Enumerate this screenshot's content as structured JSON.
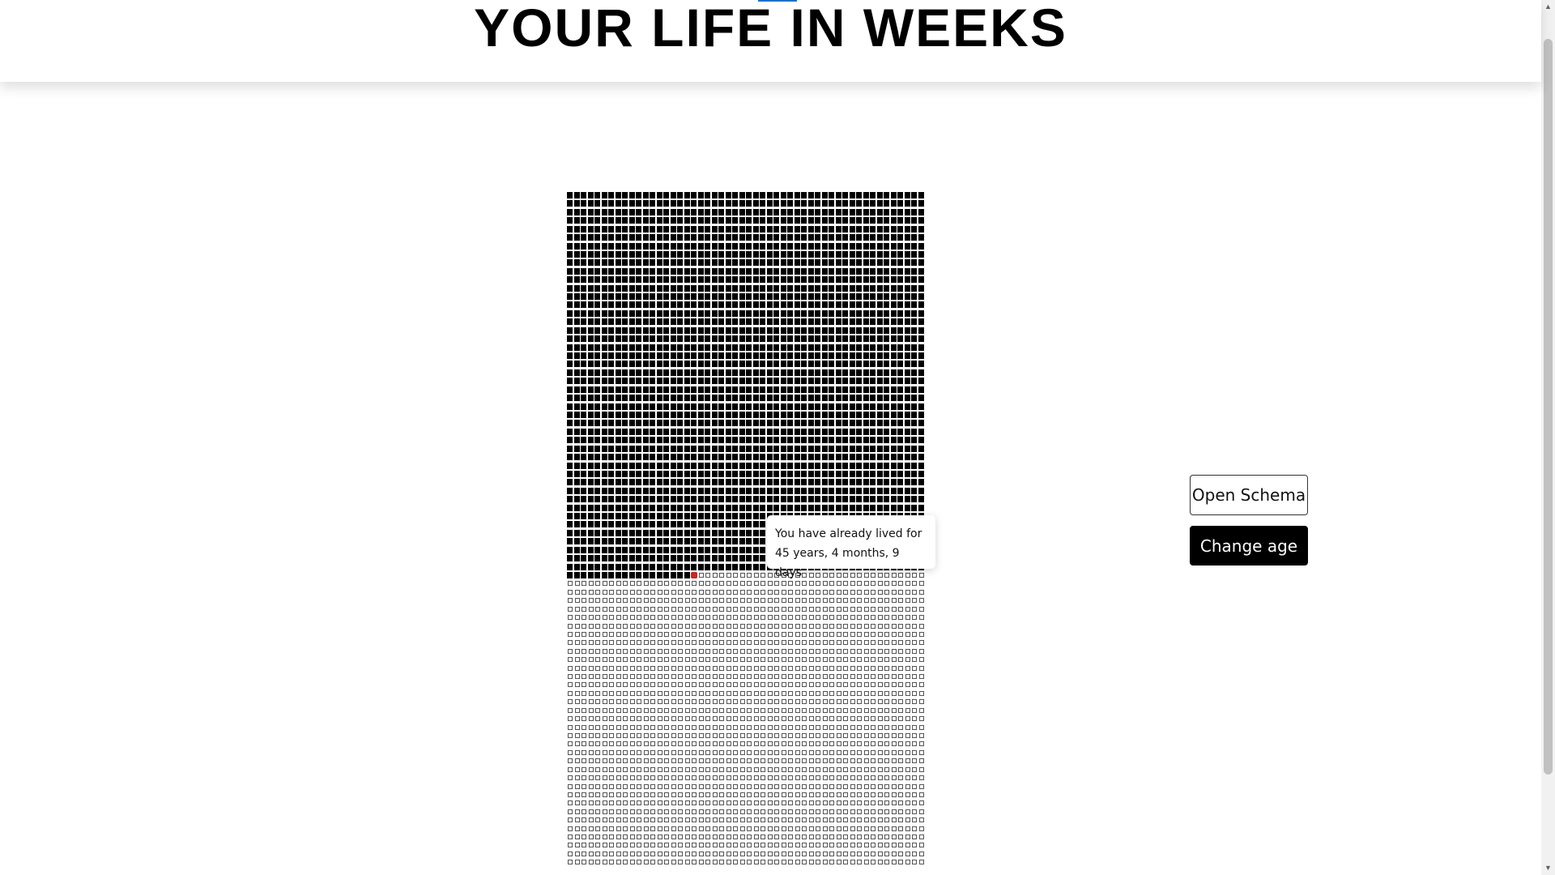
{
  "header": {
    "title": "YOUR LIFE IN WEEKS"
  },
  "grid": {
    "weeks_per_row": 52,
    "total_rows": 80,
    "lived_weeks": 2358
  },
  "tooltip": {
    "text": "You have already lived for 45 years, 4 months, 9 days"
  },
  "buttons": {
    "open_schema": "Open Schema",
    "change_age": "Change age"
  },
  "colors": {
    "lived": "#000000",
    "current_week": "#c62828",
    "future_border": "#555555"
  },
  "scrollbar": {
    "up_icon": "▲",
    "down_icon": "▼"
  }
}
